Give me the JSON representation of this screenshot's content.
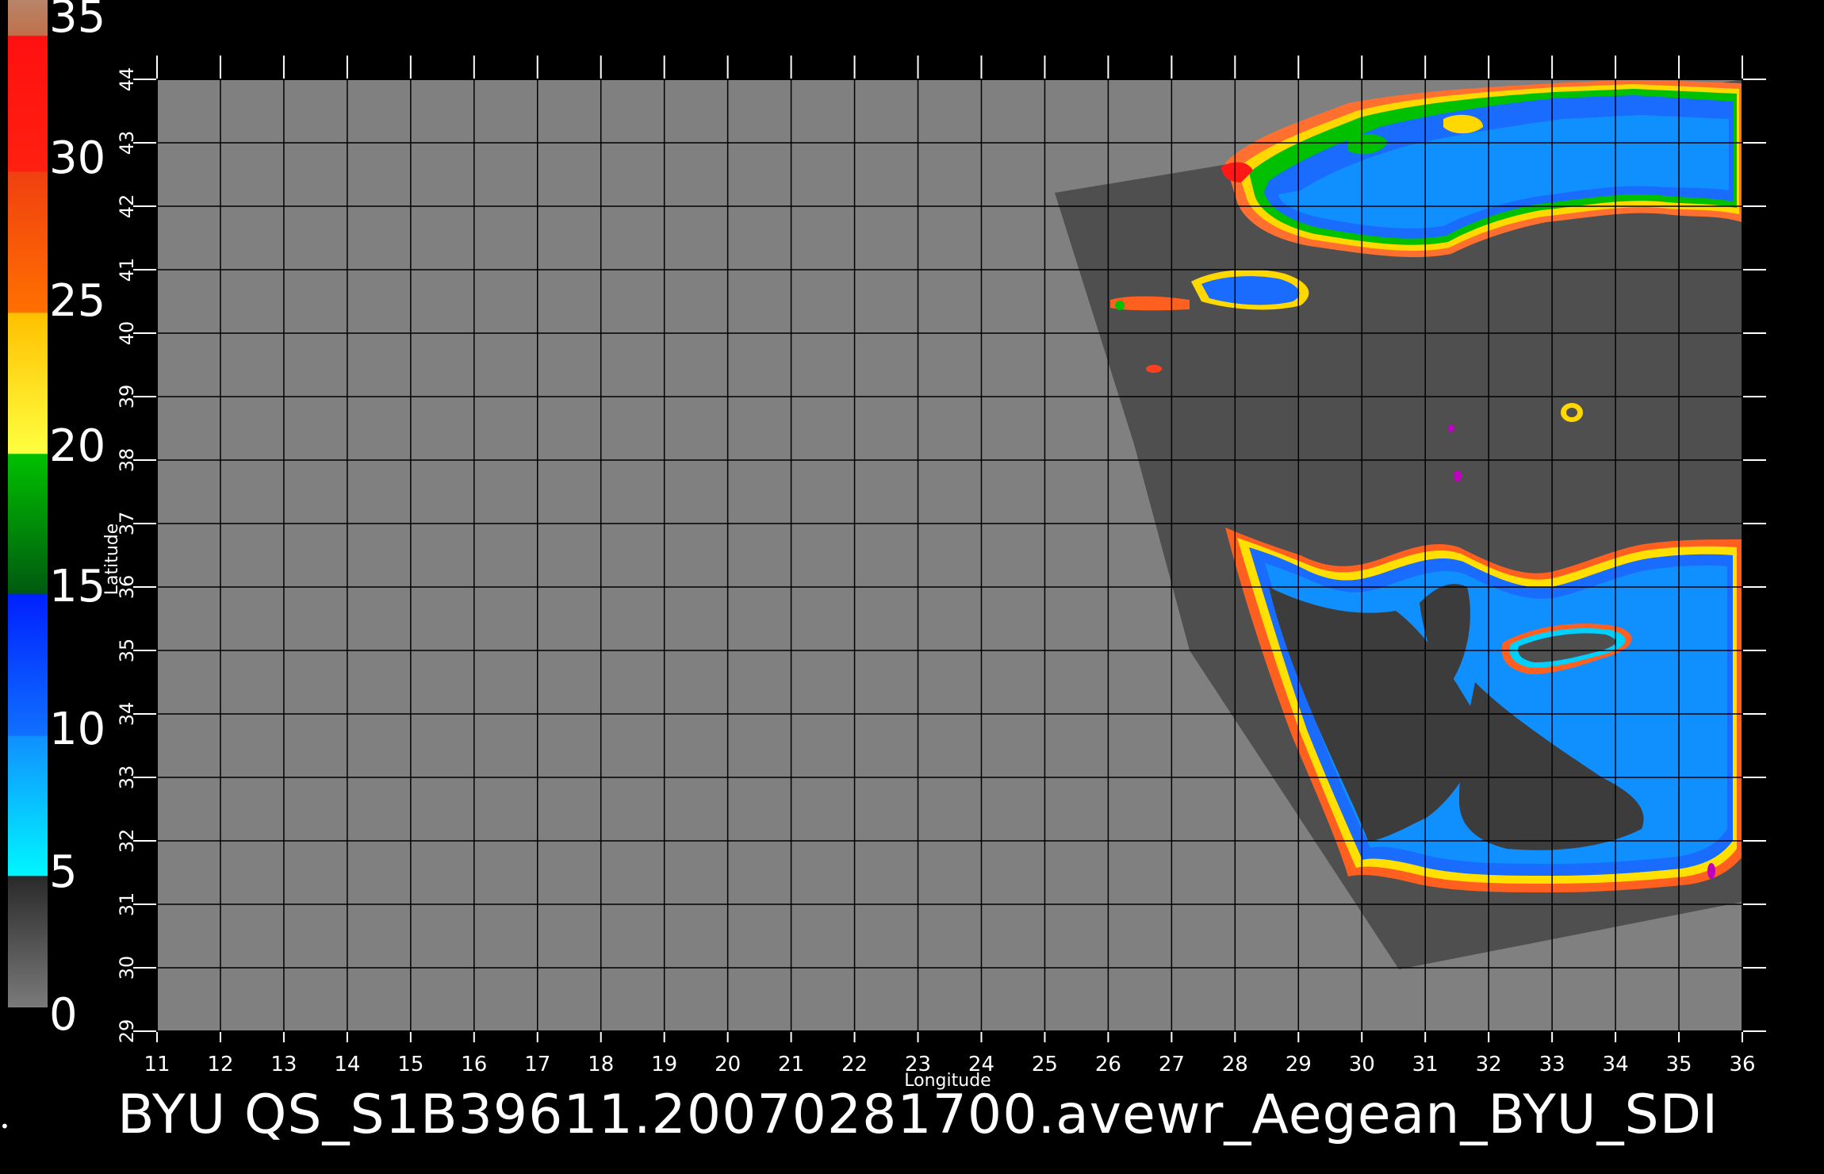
{
  "caption": "BYU  QS_S1B39611.20070281700.avewr_Aegean_BYU_SDI",
  "colorbar": {
    "labels": [
      "35",
      "30",
      "25",
      "20",
      "15",
      "10",
      "5",
      "0"
    ],
    "colors": [
      "#b8846a",
      "#ff1a1a",
      "#ff4d10",
      "#ffd000",
      "#00c000",
      "#1050ff",
      "#00f0ff",
      "#555555"
    ]
  },
  "map": {
    "xlabel": "Longitude",
    "ylabel": "Latitude",
    "lon_ticks": [
      "11",
      "12",
      "13",
      "14",
      "15",
      "16",
      "17",
      "18",
      "19",
      "20",
      "21",
      "22",
      "23",
      "24",
      "25",
      "26",
      "27",
      "28",
      "29",
      "30",
      "31",
      "32",
      "33",
      "34",
      "35",
      "36"
    ],
    "lat_ticks": [
      "29",
      "30",
      "31",
      "32",
      "33",
      "34",
      "35",
      "36",
      "37",
      "38",
      "39",
      "40",
      "41",
      "42",
      "43",
      "44"
    ],
    "lon_range": [
      11,
      36
    ],
    "lat_range": [
      29,
      44
    ],
    "background_color": "#808080",
    "swath_color": "#4f4f4f",
    "grid": true
  }
}
